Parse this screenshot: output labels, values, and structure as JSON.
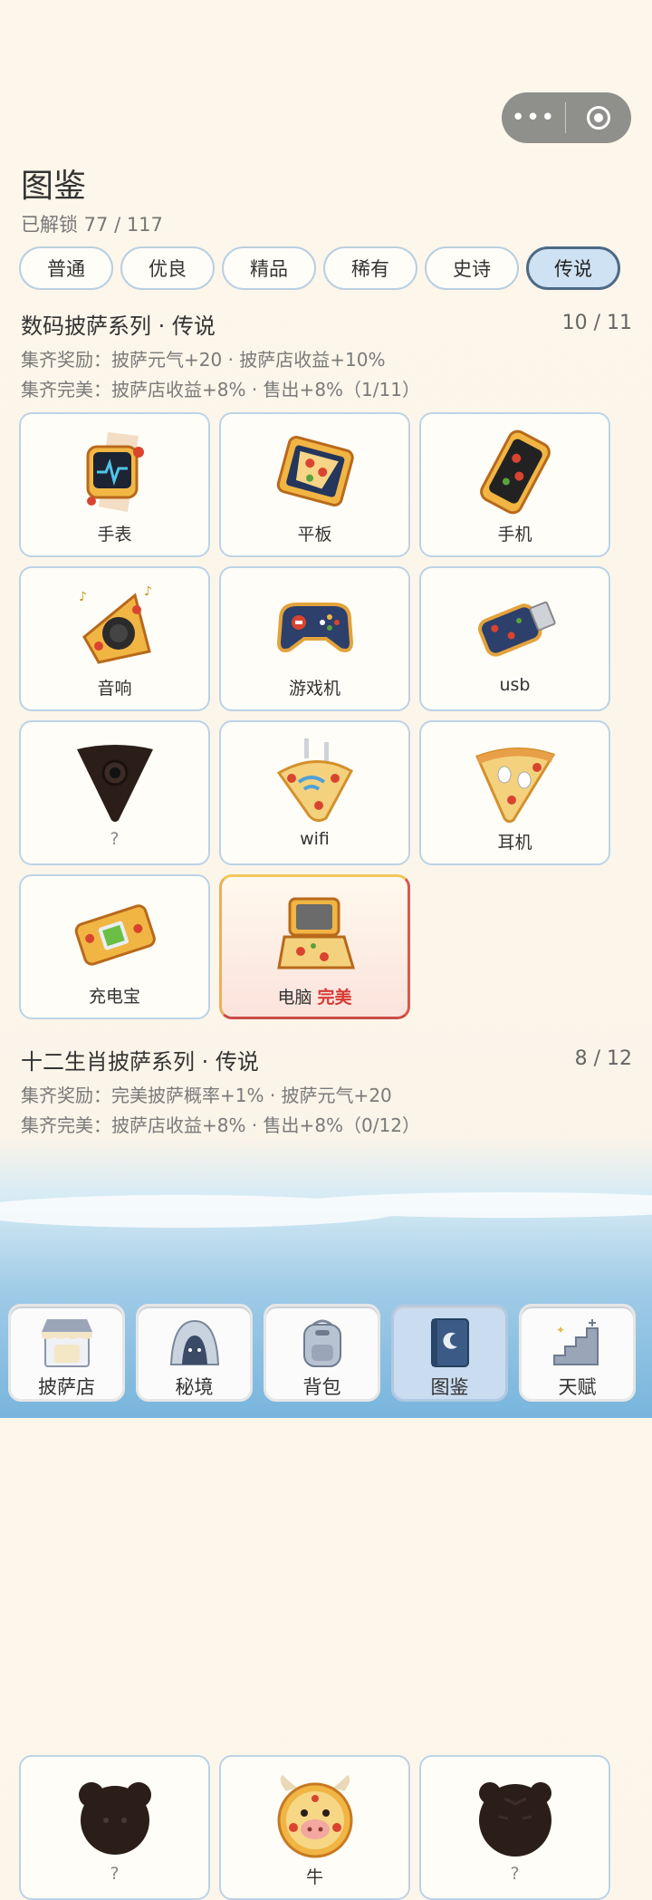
{
  "capsule": {
    "more_icon": "more-dots-icon",
    "close_icon": "target-icon"
  },
  "header": {
    "title": "图鉴",
    "progress": "已解锁 77 / 117"
  },
  "tabs": [
    "普通",
    "优良",
    "精品",
    "稀有",
    "史诗",
    "传说"
  ],
  "active_tab": "传说",
  "series": [
    {
      "title": "数码披萨系列 · 传说",
      "count": "10 / 11",
      "reward": "集齐奖励：披萨元气+20 · 披萨店收益+10%",
      "perfect": "集齐完美：披萨店收益+8% · 售出+8%（1/11）",
      "items": [
        {
          "name": "手表",
          "icon": "watch-pizza-icon"
        },
        {
          "name": "平板",
          "icon": "tablet-pizza-icon"
        },
        {
          "name": "手机",
          "icon": "phone-pizza-icon"
        },
        {
          "name": "音响",
          "icon": "speaker-pizza-icon"
        },
        {
          "name": "游戏机",
          "icon": "gamepad-pizza-icon"
        },
        {
          "name": "usb",
          "icon": "usb-pizza-icon"
        },
        {
          "name": "?",
          "icon": "locked-pizza-icon"
        },
        {
          "name": "wifi",
          "icon": "wifi-pizza-icon"
        },
        {
          "name": "耳机",
          "icon": "earbuds-pizza-icon"
        },
        {
          "name": "充电宝",
          "icon": "powerbank-pizza-icon"
        },
        {
          "name": "电脑",
          "tag": "完美",
          "icon": "laptop-pizza-icon"
        }
      ]
    },
    {
      "title": "十二生肖披萨系列 · 传说",
      "count": "8 / 12",
      "reward": "集齐奖励：完美披萨概率+1% · 披萨元气+20",
      "perfect": "集齐完美：披萨店收益+8% · 售出+8%（0/12）",
      "items": [
        {
          "name": "?",
          "icon": "locked-rat-pizza-icon"
        },
        {
          "name": "牛",
          "icon": "ox-pizza-icon"
        },
        {
          "name": "?",
          "icon": "locked-tiger-pizza-icon"
        }
      ]
    }
  ],
  "nav": [
    {
      "label": "披萨店",
      "icon": "shop-icon"
    },
    {
      "label": "秘境",
      "icon": "cave-icon"
    },
    {
      "label": "背包",
      "icon": "backpack-icon"
    },
    {
      "label": "图鉴",
      "icon": "book-icon"
    },
    {
      "label": "天赋",
      "icon": "stairs-icon"
    }
  ],
  "active_nav": "图鉴"
}
